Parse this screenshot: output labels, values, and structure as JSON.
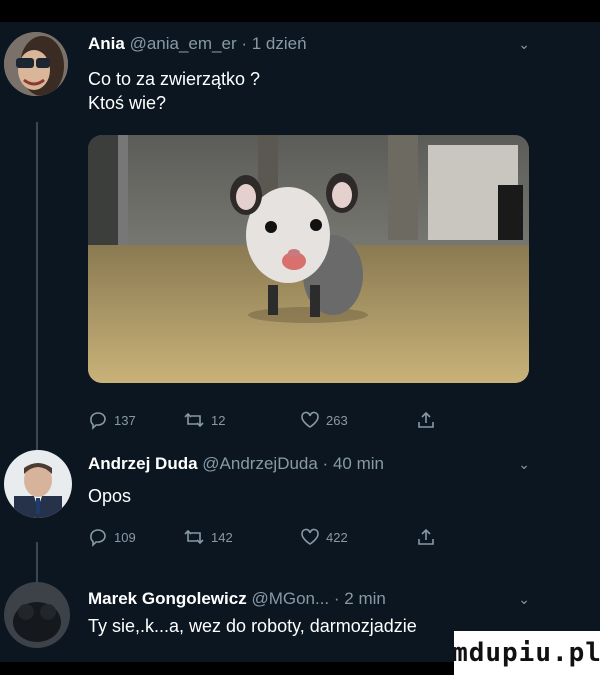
{
  "tweets": [
    {
      "name": "Ania",
      "handle_time": "@ania_em_er · 1 dzień",
      "lines": [
        "Co to za zwierzątko ?",
        "Ktoś wie?"
      ],
      "replies": "137",
      "retweets": "12",
      "likes": "263"
    },
    {
      "name": "Andrzej Duda",
      "handle_time": "@AndrzejDuda · 40 min",
      "lines": [
        "Opos"
      ],
      "replies": "109",
      "retweets": "142",
      "likes": "422"
    },
    {
      "name": "Marek Gongolewicz",
      "handle_time": "@MGon... · 2 min",
      "lines": [
        "Ty sie,.k...a, wez do roboty, darmozjadzie"
      ]
    }
  ],
  "watermark": "mdupiu.pl",
  "colors": {
    "background": "#0b1621",
    "muted": "#8899a6",
    "thread": "#3b4754"
  },
  "icons": [
    "chevron-down-icon",
    "reply-icon",
    "retweet-icon",
    "like-icon",
    "share-icon"
  ]
}
